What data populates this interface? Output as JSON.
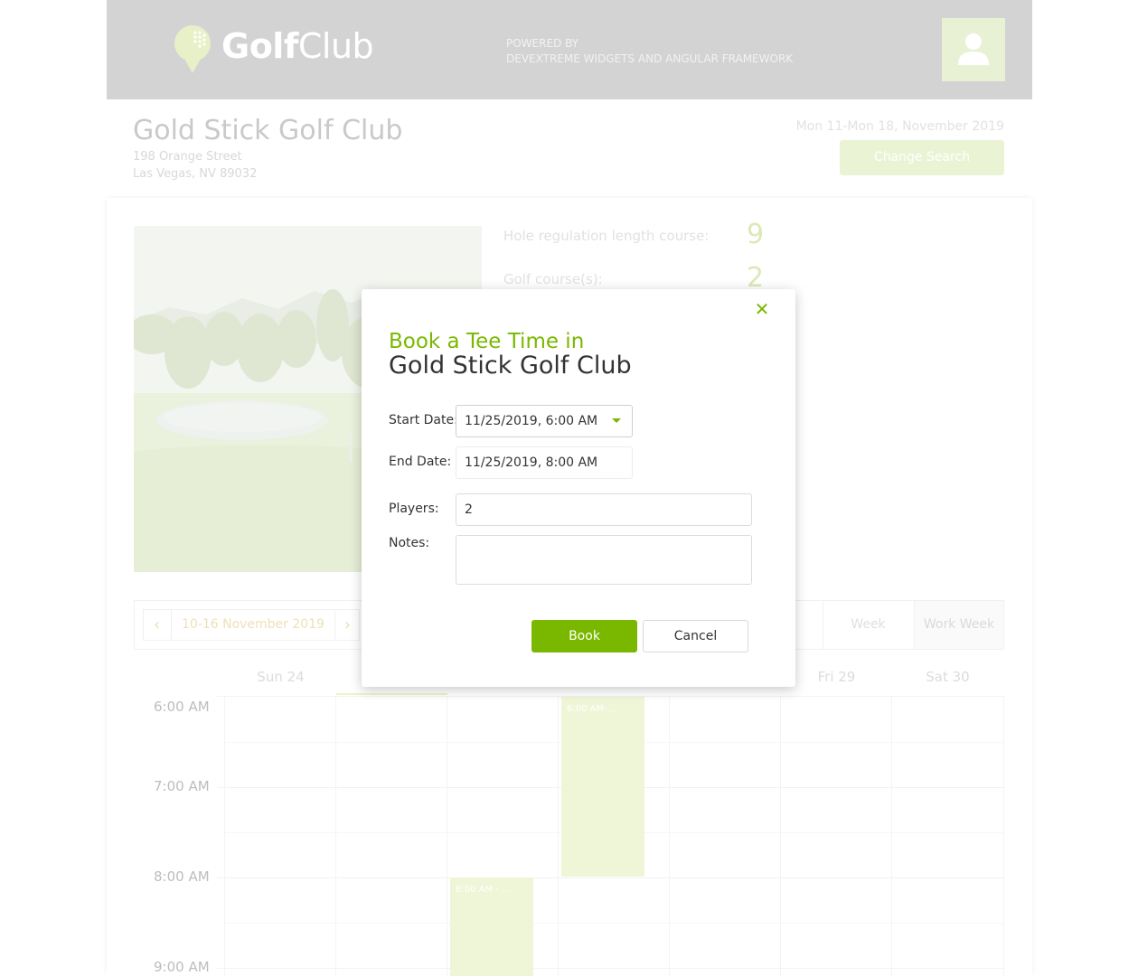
{
  "header": {
    "logo_bold": "Golf",
    "logo_light": "Club",
    "powered_line1": "POWERED BY",
    "powered_line2": "DEVEXTREME WIDGETS AND ANGULAR FRAMEWORK"
  },
  "club": {
    "name": "Gold Stick Golf Club",
    "address_line1": "198 Orange Street",
    "address_line2": "Las Vegas, NV 89032",
    "date_range": "Mon 11-Mon 18, November 2019",
    "change_search_label": "Change Search"
  },
  "stats": [
    {
      "label": "Hole regulation length course:",
      "value": "9"
    },
    {
      "label": "Golf course(s):",
      "value": "2"
    }
  ],
  "scheduler": {
    "nav_label": "10-16 November 2019",
    "views": [
      "Week",
      "Work Week"
    ],
    "days": [
      "Sun 24",
      "Fri 29",
      "Sat 30"
    ],
    "times": [
      "6:00 AM",
      "7:00 AM",
      "8:00 AM",
      "9:00 AM"
    ],
    "appointments": [
      {
        "label": "6:00 AM-..."
      },
      {
        "label": "8:00 AM - ..."
      }
    ]
  },
  "modal": {
    "kicker": "Book a Tee Time in",
    "title": "Gold Stick Golf Club",
    "start_label": "Start Date:",
    "start_value": "11/25/2019, 6:00 AM",
    "end_label": "End Date:",
    "end_value": "11/25/2019, 8:00 AM",
    "players_label": "Players:",
    "players_value": "2",
    "notes_label": "Notes:",
    "notes_value": "",
    "book_label": "Book",
    "cancel_label": "Cancel",
    "close_glyph": "✕"
  },
  "colors": {
    "accent": "#7ab800",
    "header_bg": "#d3d3d3"
  }
}
